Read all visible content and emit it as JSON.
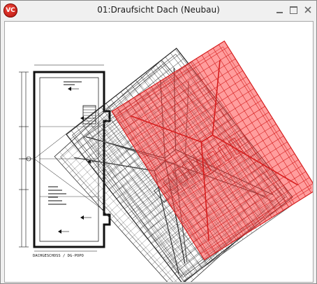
{
  "window": {
    "title": "01:Draufsicht Dach (Neubau)",
    "app_icon_label": "VC",
    "controls": {
      "minimize": "minimize",
      "maximize": "maximize",
      "close": "close"
    }
  },
  "drawing": {
    "floor_label": "DACHGESCHOSS / DG-POPO",
    "overlay_color": "#ff4d4d",
    "line_color": "#111111"
  }
}
